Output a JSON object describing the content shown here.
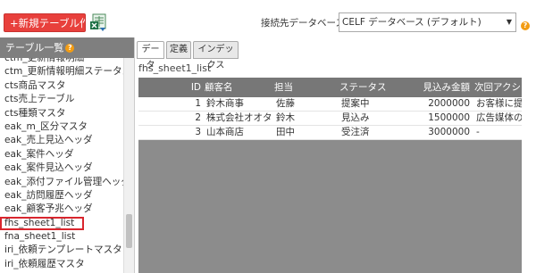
{
  "toolbar": {
    "new_table_button": "+新規テーブル作成",
    "excel_icon": "excel-export-icon"
  },
  "connection": {
    "label": "接続先データベース",
    "selected": "CELF データベース (デフォルト)",
    "help": "?"
  },
  "sidebar": {
    "header": "テーブル一覧",
    "help": "?",
    "items": [
      "ctm_更新情報明細",
      "ctm_更新情報明細ステータス",
      "cts商品マスタ",
      "cts売上テーブル",
      "cts種類マスタ",
      "eak_m_区分マスタ",
      "eak_売上見込ヘッダ",
      "eak_案件ヘッダ",
      "eak_案件見込ヘッダ",
      "eak_添付ファイル管理ヘッダ",
      "eak_訪問履歴ヘッダ",
      "eak_顧客予兆ヘッダ",
      "fhs_sheet1_list",
      "fna_sheet1_list",
      "iri_依頼テンプレートマスタ",
      "iri_依頼履歴マスタ"
    ],
    "selected": "fhs_sheet1_list"
  },
  "tabs": [
    {
      "label": "データ"
    },
    {
      "label": "定義"
    },
    {
      "label": "インデックス"
    }
  ],
  "content": {
    "title": "fhs_sheet1_list"
  },
  "grid": {
    "columns": [
      "ID",
      "顧客名",
      "担当",
      "ステータス",
      "見込み金額",
      "次回アクション"
    ],
    "rows": [
      [
        "1",
        "鈴木商事",
        "佐藤",
        "提案中",
        "2000000",
        "お客様に提案"
      ],
      [
        "2",
        "株式会社オオタ",
        "鈴木",
        "見込み",
        "1500000",
        "広告媒体のP"
      ],
      [
        "3",
        "山本商店",
        "田中",
        "受注済",
        "3000000",
        "-"
      ]
    ]
  },
  "colors": {
    "accent": "#e8403c",
    "header_gray": "#7f7f7f",
    "grid_bg": "#8c8c8c",
    "selection": "#d9262e",
    "help": "#f39c12"
  }
}
